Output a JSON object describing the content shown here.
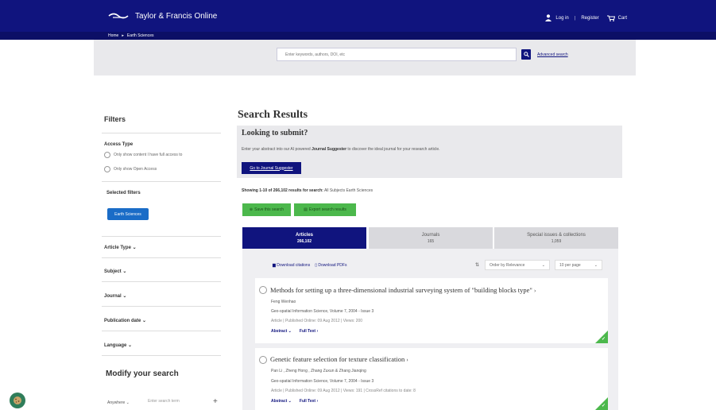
{
  "header": {
    "logo_text": "Taylor & Francis Online",
    "login": "Log in",
    "register": "Register",
    "cart": "Cart"
  },
  "breadcrumb": {
    "home": "Home",
    "sep": "▸",
    "current": "Earth Sciences"
  },
  "search": {
    "placeholder": "Enter keywords, authors, DOI, etc",
    "advanced_link": "Advanced search"
  },
  "filters": {
    "title": "Filters",
    "access_type": "Access Type",
    "option_full_access": "Only show content I have full access to",
    "option_open_access": "Only show Open Access",
    "selected_filters": "Selected filters",
    "chip": "Earth Sciences",
    "facets": [
      "Article Type",
      "Subject",
      "Journal",
      "Publication date",
      "Language"
    ]
  },
  "modify": {
    "title": "Modify your search",
    "field_select": "Anywhere",
    "term_placeholder": "Enter search term",
    "add": "+"
  },
  "results": {
    "title": "Search Results",
    "submit_title": "Looking to submit?",
    "submit_text_pre": "Enter your abstract into our AI powered",
    "submit_text_bold": "Journal Suggester",
    "submit_text_post": "to discover the ideal journal for your research article.",
    "suggester_button": "Go to Journal Suggester",
    "showing_bold": "Showing 1-10 of 266,102 results for search:",
    "showing_rest": "All Subjects Earth Sciences",
    "save_search": "Save this search",
    "export_results": "Export search results"
  },
  "tabs": [
    {
      "label": "Articles",
      "count": "266,102"
    },
    {
      "label": "Journals",
      "count": "165"
    },
    {
      "label": "Special issues & collections",
      "count": "1,059"
    }
  ],
  "toolbar": {
    "download_citations": "Download citations",
    "download_pdfs": "Download PDFs",
    "sort": "Order by Relevance",
    "per_page": "10 per page"
  },
  "articles": [
    {
      "title": "Methods for setting up a three-dimensional industrial surveying system of \"building blocks type\"",
      "authors": "Feng Wenhao",
      "source": "Geo-spatial Information Science, Volume 7, 2004 - Issue 3",
      "meta": "Article | Published Online: 09 Aug 2012 | Views: 200",
      "abstract": "Abstract",
      "full_text": "Full Text"
    },
    {
      "title": "Genetic feature selection for texture classification",
      "authors": "Pan Li , Zheng Hong , Zhang Zuxun & Zhang Jianqing",
      "source": "Geo-spatial Information Science, Volume 7, 2004 - Issue 3",
      "meta": "Article | Published Online: 09 Aug 2012 | Views: 191 | CrossRef citations to date: 8",
      "abstract": "Abstract",
      "full_text": "Full Text"
    }
  ],
  "colors": {
    "brand_navy": "#10147e",
    "green": "#4cb84c",
    "chip_blue": "#1a6cc7"
  }
}
